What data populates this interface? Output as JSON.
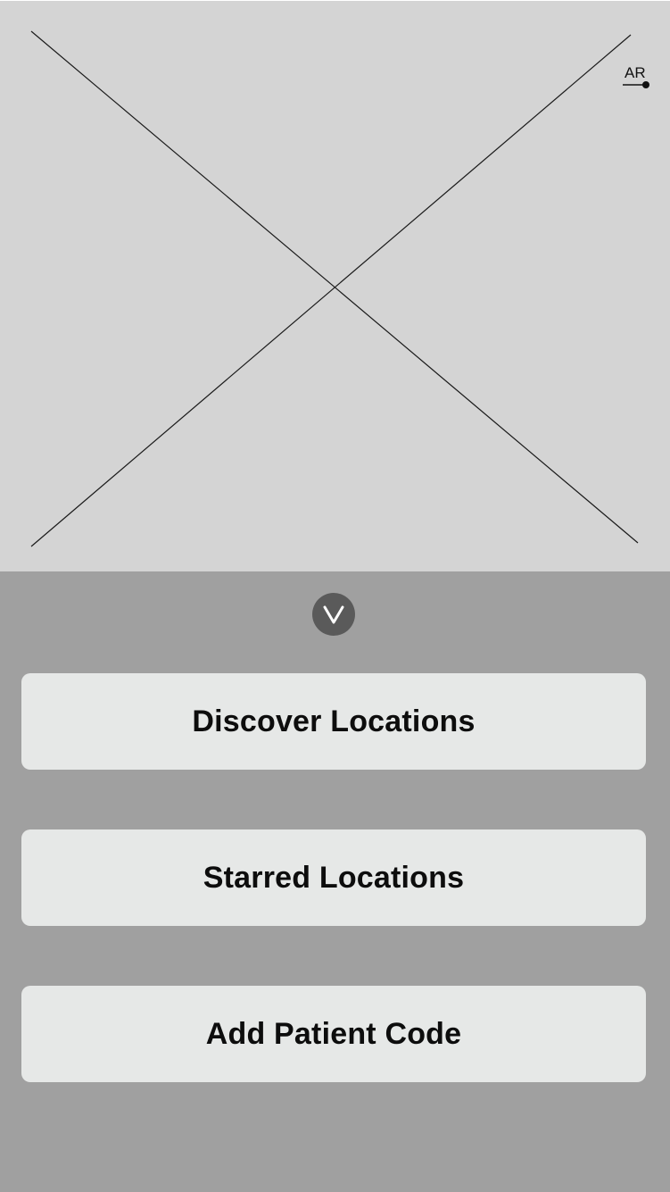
{
  "camera": {
    "ar_label": "AR"
  },
  "panel": {
    "collapse_icon": "chevron-down-icon",
    "buttons": [
      {
        "label": "Discover Locations"
      },
      {
        "label": "Starred Locations"
      },
      {
        "label": "Add Patient Code"
      }
    ]
  },
  "colors": {
    "camera_background": "#d4d4d4",
    "panel_background": "#a0a0a0",
    "button_background": "#e6e8e7",
    "collapse_button": "#5a5a5a"
  }
}
